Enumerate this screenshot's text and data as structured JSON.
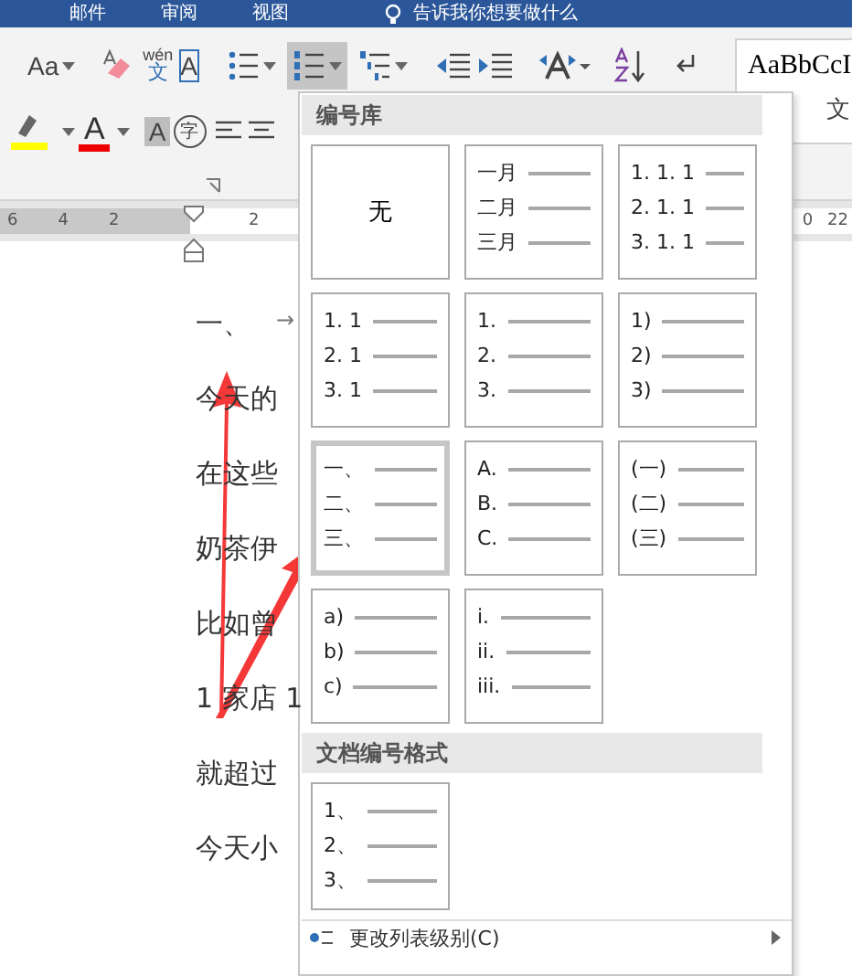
{
  "tabs": [
    {
      "label": "邮件"
    },
    {
      "label": "审阅"
    },
    {
      "label": "视图"
    }
  ],
  "tell_me": "告诉我你想要做什么",
  "ribbon": {
    "font_size_button": "Aa",
    "pinyin_top": "wén",
    "pinyin_bottom": "文",
    "char_border": "A",
    "font_color": "A",
    "char_shading": "A",
    "enclose_char": "字",
    "paragraph_buttons": [
      {
        "kind": "bullets",
        "selected": false
      },
      {
        "kind": "numbering",
        "selected": true
      },
      {
        "kind": "multilevel",
        "selected": false
      }
    ],
    "style_preview": "AaBbCcI",
    "style_name": "文"
  },
  "ruler": {
    "left_labels": [
      "6",
      "4",
      "2"
    ],
    "right_labels": [
      "2"
    ],
    "far_labels": [
      "0",
      "22"
    ]
  },
  "document": {
    "lines": [
      {
        "text": "一、",
        "tab_mark": "→"
      },
      {
        "text": "今天的"
      },
      {
        "text": "在这些"
      },
      {
        "text": "奶茶伊"
      },
      {
        "text": "比如曾"
      },
      {
        "text": "1 家店 1"
      },
      {
        "text": "就超过"
      },
      {
        "text": "今天小"
      }
    ]
  },
  "numbering_menu": {
    "library_title": "编号库",
    "library": [
      {
        "kind": "none",
        "label": "无",
        "selected": false
      },
      {
        "kind": "list",
        "lines": [
          "一月",
          "二月",
          "三月"
        ],
        "selected": false
      },
      {
        "kind": "list",
        "lines": [
          "1. 1. 1",
          "2. 1. 1",
          "3. 1. 1"
        ],
        "selected": false
      },
      {
        "kind": "list",
        "lines": [
          "1. 1",
          "2. 1",
          "3. 1"
        ],
        "selected": false
      },
      {
        "kind": "list",
        "lines": [
          "1.",
          "2.",
          "3."
        ],
        "selected": false
      },
      {
        "kind": "list",
        "lines": [
          "1)",
          "2)",
          "3)"
        ],
        "selected": false
      },
      {
        "kind": "list",
        "lines": [
          "一、",
          "二、",
          "三、"
        ],
        "selected": true
      },
      {
        "kind": "list",
        "lines": [
          "A.",
          "B.",
          "C."
        ],
        "selected": false
      },
      {
        "kind": "list",
        "lines": [
          "(一)",
          "(二)",
          "(三)"
        ],
        "selected": false
      },
      {
        "kind": "list",
        "lines": [
          "a)",
          "b)",
          "c)"
        ],
        "selected": false
      },
      {
        "kind": "list",
        "lines": [
          "i.",
          "ii.",
          "iii."
        ],
        "selected": false
      }
    ],
    "document_title": "文档编号格式",
    "document_formats": [
      {
        "kind": "list",
        "lines": [
          "1、",
          "2、",
          "3、"
        ],
        "selected": false
      }
    ],
    "items": [
      {
        "label": "更改列表级别(C)",
        "submenu": true
      }
    ]
  }
}
